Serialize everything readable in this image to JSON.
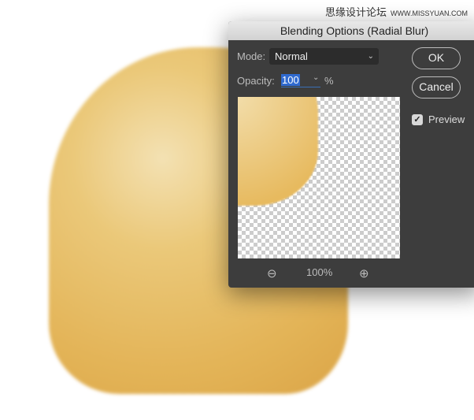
{
  "watermark": {
    "cn": "思缘设计论坛",
    "url": "WWW.MISSYUAN.COM"
  },
  "dialog": {
    "title": "Blending Options (Radial Blur)",
    "mode_label": "Mode:",
    "mode_value": "Normal",
    "opacity_label": "Opacity:",
    "opacity_value": "100",
    "opacity_unit": "%",
    "ok_label": "OK",
    "cancel_label": "Cancel",
    "preview_label": "Preview",
    "preview_checked": true,
    "zoom_level": "100%",
    "icons": {
      "zoom_out": "zoom-out-icon",
      "zoom_in": "zoom-in-icon",
      "chevron": "chevron-down-icon",
      "check": "checkmark-icon"
    }
  }
}
